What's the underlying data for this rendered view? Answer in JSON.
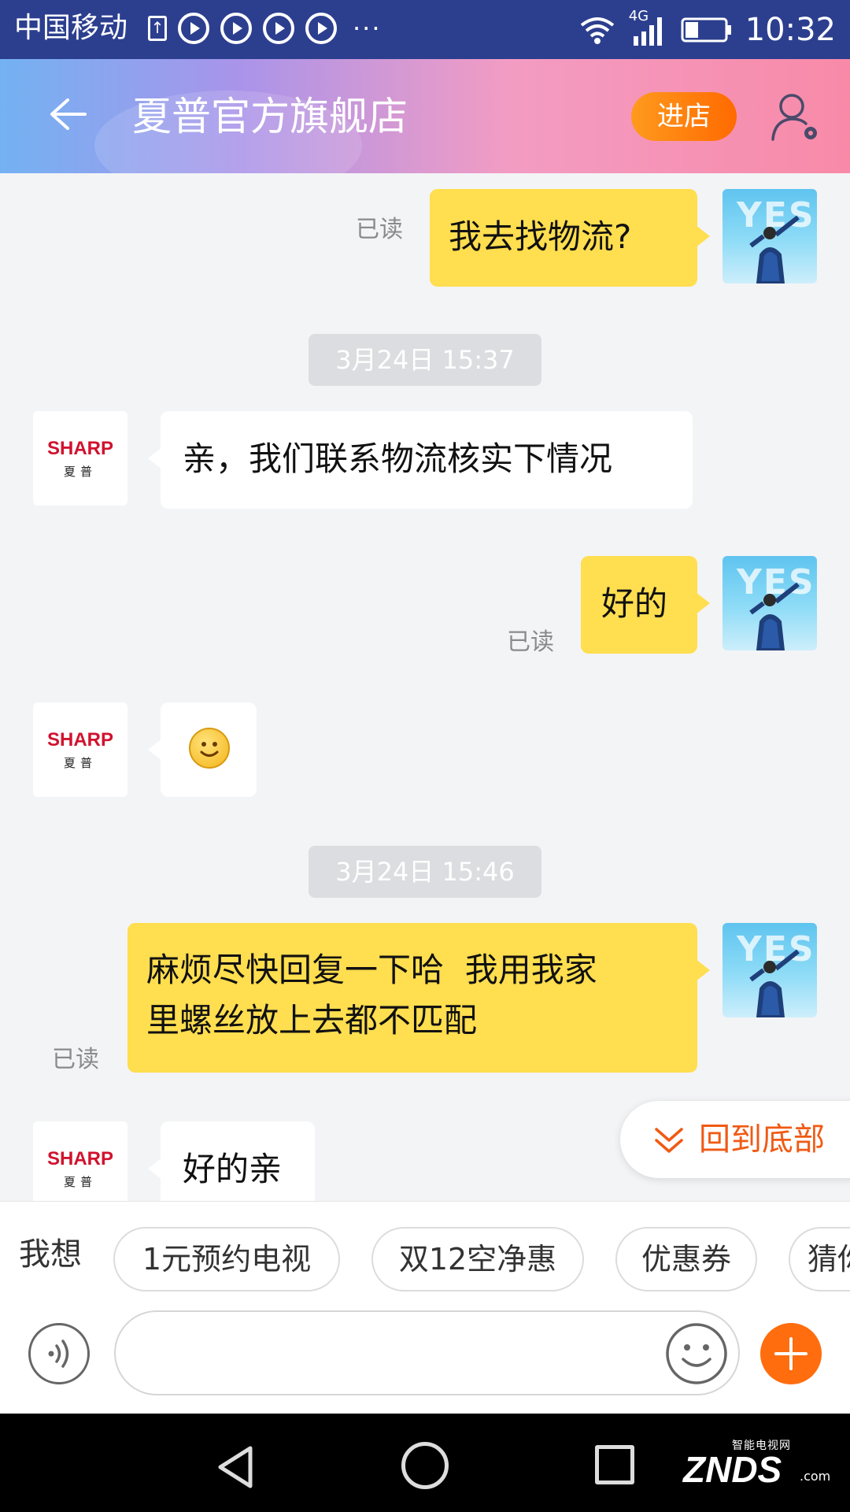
{
  "status_bar": {
    "carrier": "中国移动",
    "network": "4G",
    "time": "10:32",
    "more": "···"
  },
  "header": {
    "title": "夏普官方旗舰店",
    "enter_shop": "进店"
  },
  "shop_avatar": {
    "logo": "SHARP",
    "sub": "夏普"
  },
  "self_avatar": {
    "text": "YES"
  },
  "messages": [
    {
      "from": "self",
      "text": "我去找物流?",
      "status": "已读"
    },
    {
      "type": "time",
      "text": "3月24日 15:37"
    },
    {
      "from": "shop",
      "text": "亲，我们联系物流核实下情况"
    },
    {
      "from": "self",
      "text": "好的",
      "status": "已读"
    },
    {
      "from": "shop",
      "emoji": "smile"
    },
    {
      "type": "time",
      "text": "3月24日 15:46"
    },
    {
      "from": "self",
      "lines": [
        "麻烦尽快回复一下哈  我用我家",
        "里螺丝放上去都不匹配"
      ],
      "status": "已读"
    },
    {
      "from": "shop",
      "text": "好的亲"
    }
  ],
  "back_to_bottom": "回到底部",
  "quick_replies": {
    "label": "我想",
    "chips": [
      "1元预约电视",
      "双12空净惠",
      "优惠券",
      "猜你"
    ]
  },
  "watermark": {
    "top": "智能电视网",
    "main": "ZNDS",
    "suffix": ".com"
  },
  "colors": {
    "self_bubble": "#ffde4f",
    "accent": "#ff6d0e",
    "status_bar": "#2c3f8f"
  }
}
